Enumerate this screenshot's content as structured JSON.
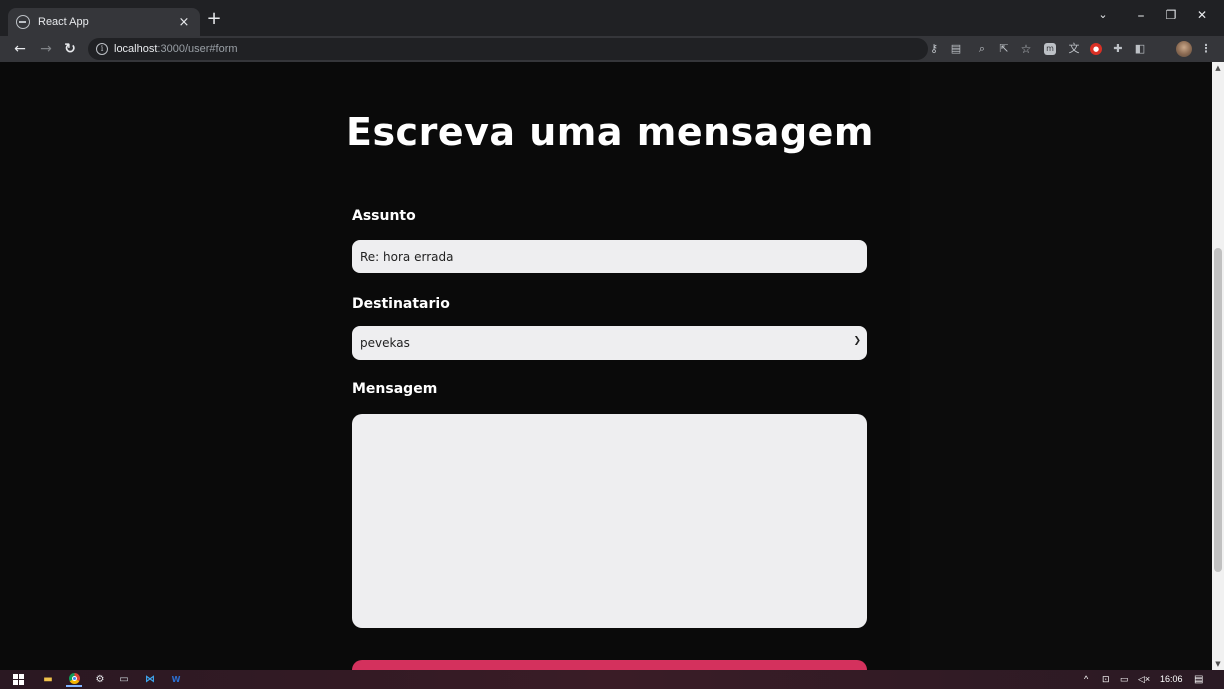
{
  "browser": {
    "tab_title": "React App",
    "tab_close": "×",
    "new_tab": "+",
    "url_host": "localhost",
    "url_path": ":3000/user#form",
    "window_controls": {
      "chevron": "⌄",
      "minimize": "–",
      "restore": "❐",
      "close": "✕"
    }
  },
  "form": {
    "heading": "Escreva uma mensagem",
    "subject_label": "Assunto",
    "subject_value": "Re: hora errada",
    "recipient_label": "Destinatario",
    "recipient_value": "pevekas",
    "message_label": "Mensagem",
    "message_value": ""
  },
  "taskbar": {
    "clock": "16:06"
  },
  "colors": {
    "page_bg": "#0c0c0c",
    "field_bg": "#eeeef0",
    "submit_bg": "#d4315d"
  }
}
